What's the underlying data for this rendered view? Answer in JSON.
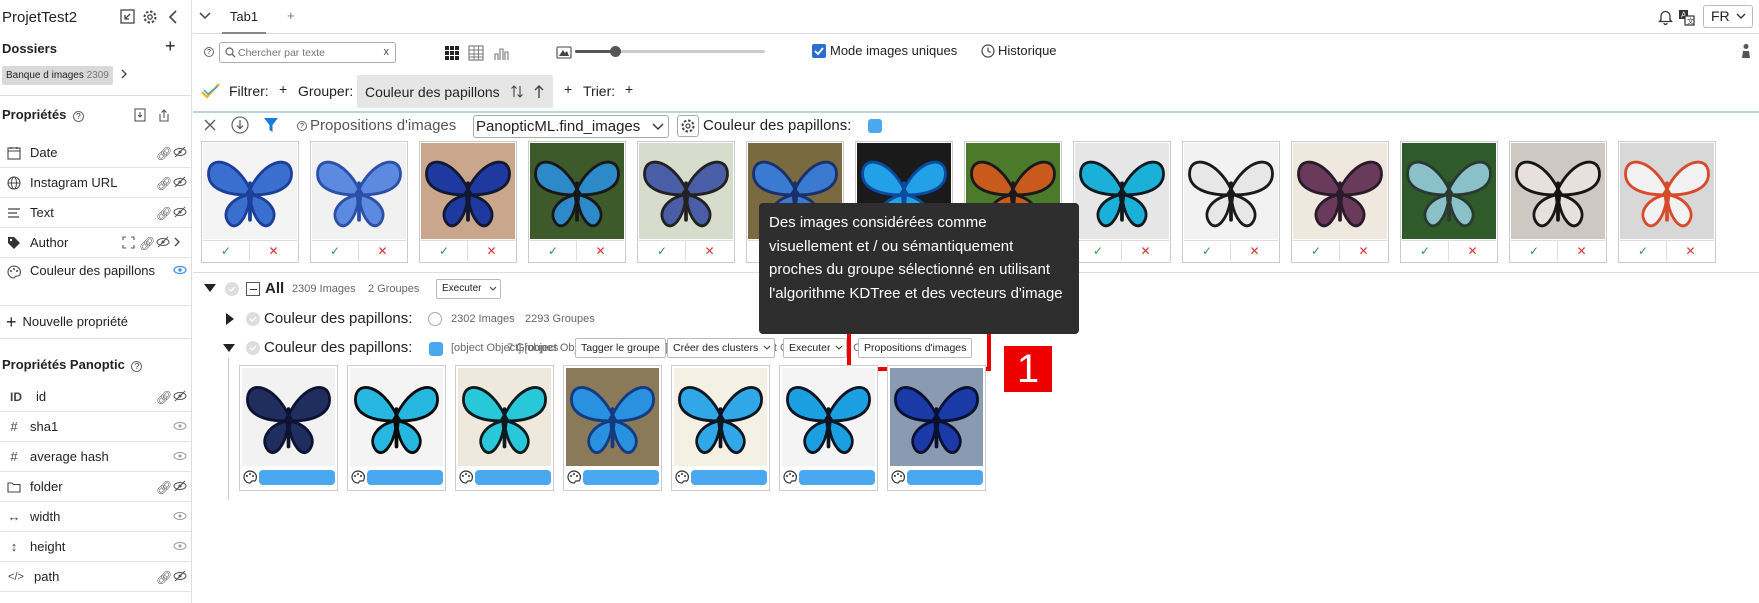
{
  "app": {
    "project_name": "ProjetTest2",
    "tab": "Tab1",
    "add_tab": "+",
    "language": "FR"
  },
  "sidebar": {
    "folders_title": "Dossiers",
    "add_label": "+",
    "folder_chip": {
      "name": "Banque d images",
      "count": "2309"
    },
    "properties_title": "Propriétés",
    "properties": [
      {
        "label": "Date",
        "icon": "calendar-icon"
      },
      {
        "label": "Instagram URL",
        "icon": "globe-icon"
      },
      {
        "label": "Text",
        "icon": "text-icon"
      },
      {
        "label": "Author",
        "icon": "tag-icon"
      },
      {
        "label": "Couleur des papillons",
        "icon": "palette-icon"
      }
    ],
    "new_property": "Nouvelle propriété",
    "panoptic_title": "Propriétés Panoptic",
    "panoptic": [
      {
        "label": "id",
        "glyph": "ID"
      },
      {
        "label": "sha1",
        "glyph": "#"
      },
      {
        "label": "average hash",
        "glyph": "#"
      },
      {
        "label": "folder",
        "glyph": "folder"
      },
      {
        "label": "width",
        "glyph": "↔"
      },
      {
        "label": "height",
        "glyph": "↕"
      },
      {
        "label": "path",
        "glyph": "</>"
      }
    ]
  },
  "toolbar": {
    "search_placeholder": "Chercher par texte",
    "search_clear": "x",
    "unique_mode_label": "Mode images uniques",
    "unique_mode_checked": true,
    "history_label": "Historique",
    "filter_label": "Filtrer:",
    "group_label": "Grouper:",
    "group_chip": "Couleur des papillons",
    "sort_label": "Trier:",
    "zoom_level": 0.21
  },
  "proposals": {
    "title": "Propositions d'images",
    "function": "PanopticML.find_images",
    "property_label": "Couleur des papillons:",
    "accept": "✓",
    "reject": "✕",
    "images": [
      {
        "colors": [
          "#f4f4f4",
          "#3a6fd0",
          "#1c3f9a"
        ]
      },
      {
        "colors": [
          "#f1f1f1",
          "#5b8ae0",
          "#2c4fa8"
        ]
      },
      {
        "colors": [
          "#caa78c",
          "#1e3aa0",
          "#111831"
        ]
      },
      {
        "colors": [
          "#3c5a2a",
          "#2c8ac8",
          "#181818"
        ]
      },
      {
        "colors": [
          "#d8dccd",
          "#4a5ea8",
          "#222222"
        ]
      },
      {
        "colors": [
          "#7a6a40",
          "#3a7ad0",
          "#1b2f6a"
        ]
      },
      {
        "colors": [
          "#1a1a1a",
          "#22a0e8",
          "#0a4ba0"
        ]
      },
      {
        "colors": [
          "#4a7a2a",
          "#c85a1e",
          "#1a1a1a"
        ]
      },
      {
        "colors": [
          "#e6e6e6",
          "#1ab0d8",
          "#101820"
        ]
      },
      {
        "colors": [
          "#f2f2f2",
          "#e7e7e7",
          "#1a1a1a"
        ]
      },
      {
        "colors": [
          "#efe8de",
          "#6a3a5a",
          "#2a1a2a"
        ]
      },
      {
        "colors": [
          "#2f5a2a",
          "#8ac0c8",
          "#2a3a30"
        ]
      },
      {
        "colors": [
          "#cfc7c2",
          "#e8e0dc",
          "#151515"
        ]
      },
      {
        "colors": [
          "#d8d8d8",
          "#f2f2f2",
          "#d84a2a"
        ]
      }
    ]
  },
  "groups": {
    "all_label": "All",
    "all_images": "2309 Images",
    "all_groups": "2 Groupes",
    "execute": "Executer",
    "group1": {
      "label": "Couleur des papillons:",
      "images": "2302 Images",
      "groups": "2293 Groupes"
    },
    "group2": {
      "label": "Couleur des papillons:",
      "images": [
        {
          "colors": [
            "#f2f2f2",
            "#1f2e5e",
            "#0e1330"
          ]
        },
        {
          "colors": [
            "#f4f4f4",
            "#25b7e0",
            "#0b0b0b"
          ]
        },
        {
          "colors": [
            "#efe8dc",
            "#28c8d8",
            "#0e1a20"
          ]
        },
        {
          "colors": [
            "#8a7a5a",
            "#2a90e0",
            "#143a80"
          ]
        },
        {
          "colors": [
            "#f4f0e4",
            "#30a8e8",
            "#0e1520"
          ]
        },
        {
          "colors": [
            "#f4f4f4",
            "#1aa0e0",
            "#0e1424"
          ]
        },
        {
          "colors": [
            "#8a9ab0",
            "#1a3aa8",
            "#0a1030"
          ]
        }
      ],
      "groups": "7 Groupes",
      "tag_btn": "Tagger le groupe",
      "cluster_btn": "Créer des clusters",
      "execute_btn": "Executer",
      "proposals_btn": "Propositions d'images",
      "color": "#4aa8f0"
    }
  },
  "tooltip": {
    "text": "Des images considérées comme visuellement et / ou sémantiquement proches du groupe sélectionné en utilisant l'algorithme KDTree et des vecteurs d'image"
  },
  "annotation": {
    "marker": "1",
    "color": "#ee0000"
  }
}
